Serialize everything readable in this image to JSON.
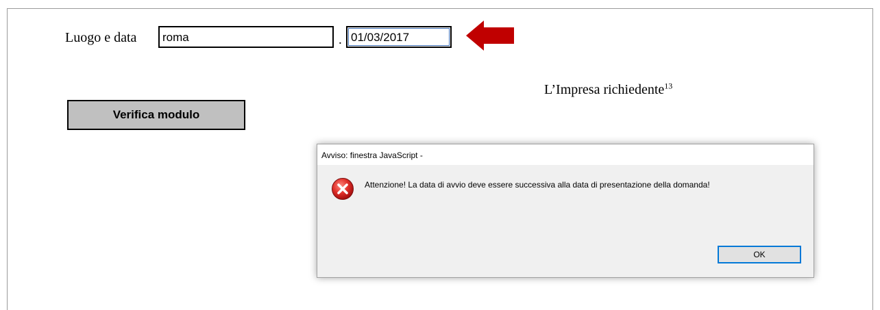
{
  "form": {
    "place_label": "Luogo e data",
    "place_value": "roma",
    "separator": ".",
    "date_value": "01/03/2017",
    "company_label": "L’Impresa richiedente",
    "company_footnote": "13",
    "verify_button": "Verifica modulo"
  },
  "arrow": {
    "icon": "arrow-left-icon",
    "color": "#c00000"
  },
  "dialog": {
    "title": "Avviso: finestra JavaScript -",
    "icon": "error-icon",
    "message": "Attenzione! La data di avvio deve essere successiva alla data di presentazione della domanda!",
    "ok_label": "OK"
  }
}
